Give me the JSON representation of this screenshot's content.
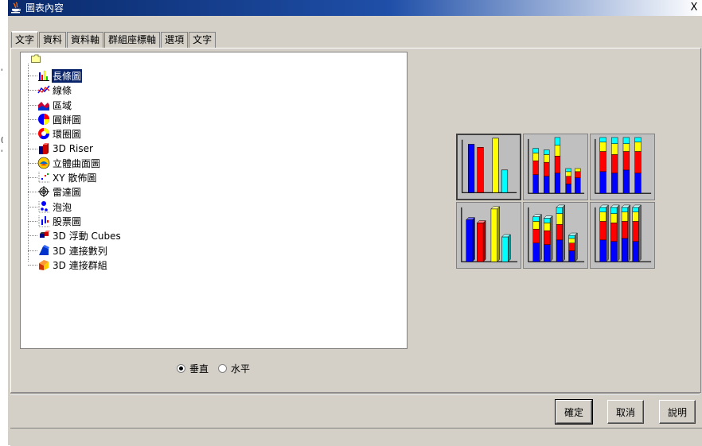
{
  "window": {
    "title": "圖表內容",
    "close_glyph": "X"
  },
  "tabs": [
    {
      "label": "文字",
      "active": true
    },
    {
      "label": "資料"
    },
    {
      "label": "資料軸"
    },
    {
      "label": "群組座標軸"
    },
    {
      "label": "選項"
    },
    {
      "label": "文字"
    }
  ],
  "tree": {
    "items": [
      {
        "label": "長條圖",
        "icon": "bar-chart-icon",
        "selected": true
      },
      {
        "label": "線條",
        "icon": "line-chart-icon"
      },
      {
        "label": "區域",
        "icon": "area-chart-icon"
      },
      {
        "label": "圓餅圖",
        "icon": "pie-chart-icon"
      },
      {
        "label": "環圈圖",
        "icon": "donut-chart-icon"
      },
      {
        "label": "3D Riser",
        "icon": "3d-riser-icon"
      },
      {
        "label": "立體曲面圖",
        "icon": "surface-chart-icon"
      },
      {
        "label": "XY 散佈圖",
        "icon": "scatter-chart-icon"
      },
      {
        "label": "雷達圖",
        "icon": "radar-chart-icon"
      },
      {
        "label": "泡泡",
        "icon": "bubble-chart-icon"
      },
      {
        "label": "股票圖",
        "icon": "stock-chart-icon"
      },
      {
        "label": "3D 浮動 Cubes",
        "icon": "3d-cubes-icon"
      },
      {
        "label": "3D 連接數列",
        "icon": "3d-connected-series-icon"
      },
      {
        "label": "3D 連接群組",
        "icon": "3d-connected-groups-icon"
      }
    ]
  },
  "subtypes": [
    {
      "name": "clustered-bar",
      "selected": true
    },
    {
      "name": "stacked-bar"
    },
    {
      "name": "percent-stacked-bar"
    },
    {
      "name": "3d-clustered-bar"
    },
    {
      "name": "3d-stacked-bar"
    },
    {
      "name": "3d-percent-stacked-bar"
    }
  ],
  "orientation": {
    "options": [
      {
        "label": "垂直",
        "checked": true
      },
      {
        "label": "水平",
        "checked": false
      }
    ]
  },
  "buttons": {
    "ok": "確定",
    "cancel": "取消",
    "help": "說明"
  },
  "side_fragments": [
    "'",
    "(",
    "'"
  ],
  "colors": {
    "blue": "#0000ff",
    "red": "#ff0000",
    "yellow": "#ffff00",
    "cyan": "#00ffff",
    "selection": "#0a246a"
  }
}
